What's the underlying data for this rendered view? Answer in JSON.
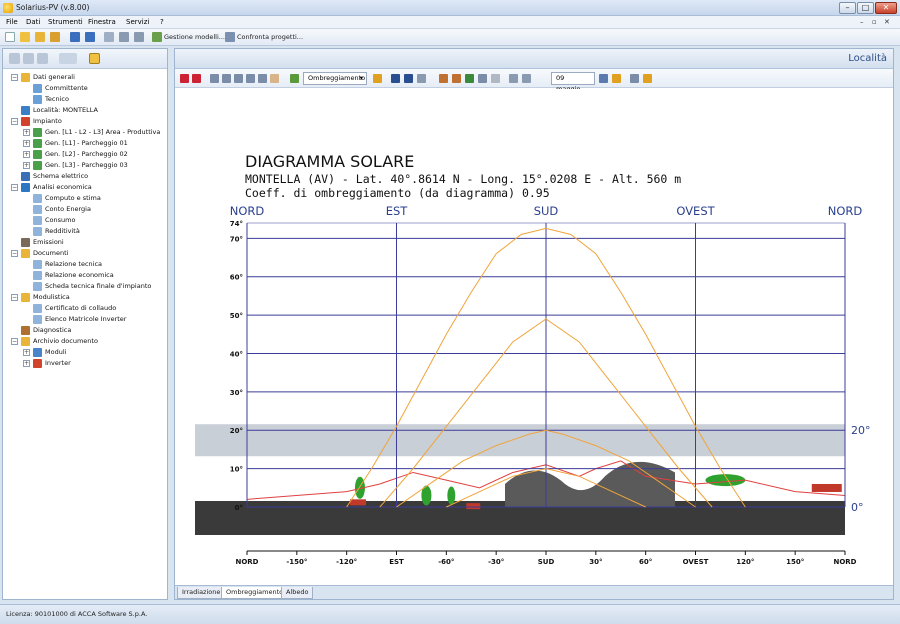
{
  "window": {
    "title": "Solarius-PV (v.8.00)",
    "controls": {
      "minimize": "–",
      "maximize": "□",
      "close": "✕"
    }
  },
  "menu": {
    "items": [
      "File",
      "Dati",
      "Strumenti",
      "Finestra",
      "Servizi",
      "?"
    ],
    "mdi_controls": [
      "–",
      "▫",
      "✕"
    ]
  },
  "toolbar": {
    "gestione_label": "Gestione modelli...",
    "confronta_label": "Confronta progetti..."
  },
  "sidebar": {
    "tree": [
      {
        "label": "Dati generali",
        "level": 0,
        "expander": "−",
        "icon": "folder-icon",
        "color": "#e8b53a"
      },
      {
        "label": "Committente",
        "level": 1,
        "icon": "person-icon",
        "color": "#6a9fd8"
      },
      {
        "label": "Tecnico",
        "level": 1,
        "icon": "person-icon",
        "color": "#6a9fd8"
      },
      {
        "label": "Località: MONTELLA",
        "level": 0,
        "icon": "globe-icon",
        "color": "#3b7fc6"
      },
      {
        "label": "Impianto",
        "level": 0,
        "expander": "−",
        "icon": "panel-icon",
        "color": "#d1432a"
      },
      {
        "label": "Gen. [L1 - L2 - L3] Area - Produttiva",
        "level": 1,
        "expander": "+",
        "icon": "generator-icon",
        "color": "#4aa04a"
      },
      {
        "label": "Gen. [L1] - Parcheggio 01",
        "level": 1,
        "expander": "+",
        "icon": "generator-icon",
        "color": "#4aa04a"
      },
      {
        "label": "Gen. [L2] - Parcheggio 02",
        "level": 1,
        "expander": "+",
        "icon": "generator-icon",
        "color": "#4aa04a"
      },
      {
        "label": "Gen. [L3] - Parcheggio 03",
        "level": 1,
        "expander": "+",
        "icon": "generator-icon",
        "color": "#4aa04a"
      },
      {
        "label": "Schema elettrico",
        "level": 0,
        "icon": "schematic-icon",
        "color": "#3a6fb5"
      },
      {
        "label": "Analisi economica",
        "level": 0,
        "expander": "−",
        "icon": "euro-icon",
        "color": "#2d77c2"
      },
      {
        "label": "Computo e stima",
        "level": 1,
        "icon": "document-icon",
        "color": "#8fb3db"
      },
      {
        "label": "Conto Energia",
        "level": 1,
        "icon": "document-icon",
        "color": "#8fb3db"
      },
      {
        "label": "Consumo",
        "level": 1,
        "icon": "document-icon",
        "color": "#8fb3db"
      },
      {
        "label": "Redditività",
        "level": 1,
        "icon": "chart-icon",
        "color": "#8fb3db"
      },
      {
        "label": "Emissioni",
        "level": 0,
        "icon": "factory-icon",
        "color": "#7a6a5a"
      },
      {
        "label": "Documenti",
        "level": 0,
        "expander": "−",
        "icon": "folder-icon",
        "color": "#e8b53a"
      },
      {
        "label": "Relazione tecnica",
        "level": 1,
        "icon": "document-icon",
        "color": "#8fb3db"
      },
      {
        "label": "Relazione economica",
        "level": 1,
        "icon": "document-icon",
        "color": "#8fb3db"
      },
      {
        "label": "Scheda tecnica finale d'impianto",
        "level": 1,
        "icon": "document-icon",
        "color": "#8fb3db"
      },
      {
        "label": "Modulistica",
        "level": 0,
        "expander": "−",
        "icon": "folder-icon",
        "color": "#e8b53a"
      },
      {
        "label": "Certificato di collaudo",
        "level": 1,
        "icon": "document-icon",
        "color": "#8fb3db"
      },
      {
        "label": "Elenco Matricole Inverter",
        "level": 1,
        "icon": "document-icon",
        "color": "#8fb3db"
      },
      {
        "label": "Diagnostica",
        "level": 0,
        "icon": "diagnostic-icon",
        "color": "#b07030"
      },
      {
        "label": "Archivio documento",
        "level": 0,
        "expander": "−",
        "icon": "archive-icon",
        "color": "#e8b53a"
      },
      {
        "label": "Moduli",
        "level": 1,
        "expander": "+",
        "icon": "module-icon",
        "color": "#4a84c8"
      },
      {
        "label": "Inverter",
        "level": 1,
        "expander": "+",
        "icon": "inverter-icon",
        "color": "#d1432a"
      }
    ]
  },
  "content": {
    "header_title": "Località",
    "toolbar_dropdown": "Ombreggiamento",
    "date_field": "09 maggio"
  },
  "diagram": {
    "title": "DIAGRAMMA SOLARE",
    "location_line": "MONTELLA (AV) - Lat. 40°.8614 N - Long. 15°.0208 E - Alt. 560 m",
    "coeff_line": "Coeff. di ombreggiamento (da diagramma) 0.95",
    "top_directions": [
      "NORD",
      "EST",
      "SUD",
      "OVEST",
      "NORD"
    ],
    "y_ticks": [
      "74°",
      "70°",
      "60°",
      "50°",
      "40°",
      "30°",
      "20°",
      "10°",
      "0°"
    ],
    "x_ticks": [
      "NORD",
      "-150°",
      "-120°",
      "EST",
      "-60°",
      "-30°",
      "SUD",
      "30°",
      "60°",
      "OVEST",
      "120°",
      "150°",
      "NORD"
    ],
    "right_labels": [
      "20°",
      "0°"
    ],
    "colors": {
      "grid": "#3c3c9a",
      "sun_path": "#f0a43a",
      "horizon": "#e04040",
      "text_blue": "#2a3f8f"
    }
  },
  "chart_data": {
    "type": "line",
    "title": "DIAGRAMMA SOLARE",
    "xlabel": "",
    "ylabel": "",
    "xlim": [
      -180,
      180
    ],
    "ylim": [
      0,
      74
    ],
    "x_ticks": [
      -180,
      -150,
      -120,
      -90,
      -60,
      -30,
      0,
      30,
      60,
      90,
      120,
      150,
      180
    ],
    "y_ticks": [
      0,
      10,
      20,
      30,
      40,
      50,
      60,
      70,
      74
    ],
    "grid": true,
    "series": [
      {
        "x": [
          -120,
          -105,
          -90,
          -75,
          -60,
          -45,
          -30,
          -15,
          0,
          15,
          30,
          45,
          60,
          75,
          90,
          105,
          120
        ],
        "y": [
          0,
          10,
          21,
          33,
          45,
          56,
          66,
          71,
          72.6,
          71,
          66,
          56,
          45,
          33,
          21,
          10,
          0
        ]
      },
      {
        "x": [
          -100,
          -80,
          -60,
          -40,
          -20,
          0,
          20,
          40,
          60,
          80,
          100
        ],
        "y": [
          0,
          10,
          21,
          32,
          43,
          49,
          43,
          32,
          21,
          10,
          0
        ]
      },
      {
        "x": [
          -90,
          -70,
          -50,
          -30,
          -10,
          0,
          10,
          30,
          50,
          70,
          90
        ],
        "y": [
          0,
          6,
          12,
          16,
          19,
          20,
          19,
          16,
          12,
          6,
          0
        ]
      },
      {
        "x": [
          -60,
          -40,
          -20,
          0,
          20,
          40,
          60
        ],
        "y": [
          0,
          4,
          8,
          10,
          8,
          4,
          0
        ]
      }
    ]
  },
  "bottom_tabs": [
    "Irradiazione",
    "Ombreggiamento",
    "Albedo"
  ],
  "statusbar": {
    "text": "Licenza: 90101000 di ACCA Software S.p.A."
  }
}
